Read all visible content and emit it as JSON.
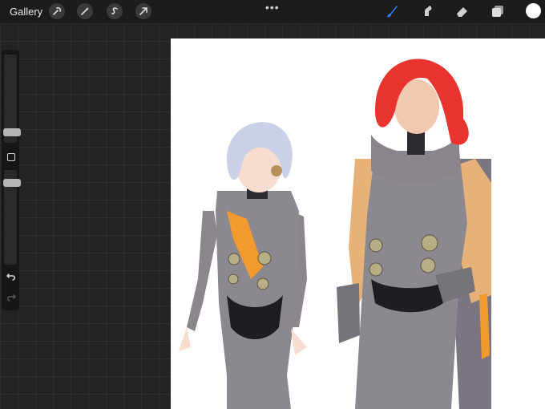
{
  "topbar": {
    "gallery_label": "Gallery",
    "more_label": "•••",
    "left_tools": [
      "wrench-icon",
      "magic-wand-icon",
      "selection-icon",
      "transform-arrow-icon"
    ],
    "right_tools": [
      "brush-icon",
      "smudge-icon",
      "eraser-icon",
      "layers-icon"
    ],
    "active_tool": "brush-icon",
    "active_color": "#ffffff",
    "accent_color": "#2f8cf6"
  },
  "sidebar": {
    "brush_size_level": 0.35,
    "opacity_level": 0.55,
    "modify_button": "square-icon",
    "undo": "undo-icon",
    "redo": "redo-icon"
  },
  "canvas": {
    "background": "#ffffff",
    "artwork": "two-characters-illustration"
  }
}
